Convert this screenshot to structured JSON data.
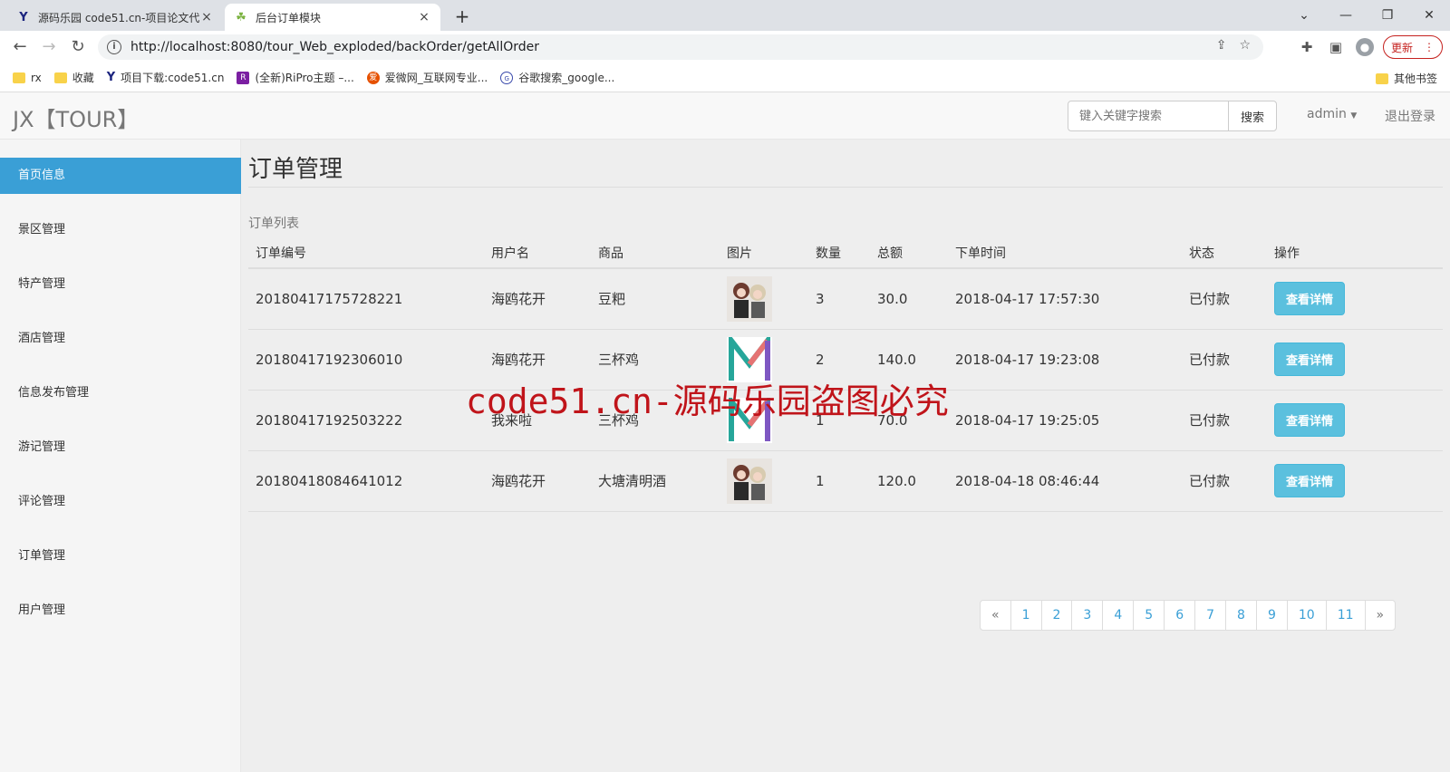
{
  "browser": {
    "tabs": [
      {
        "title": "源码乐园 code51.cn-项目论文代",
        "close": "×"
      },
      {
        "title": "后台订单模块",
        "close": "×"
      }
    ],
    "new_tab": "+",
    "window_controls": [
      "⌄",
      "—",
      "❐",
      "✕"
    ],
    "url": "http://localhost:8080/tour_Web_exploded/backOrder/getAllOrder",
    "update_label": "更新",
    "bookmarks": [
      {
        "label": "rx",
        "icon": "folder-icon"
      },
      {
        "label": "收藏",
        "icon": "folder-icon"
      },
      {
        "label": "项目下载:code51.cn",
        "icon": "y-logo-icon"
      },
      {
        "label": "(全新)RiPro主题 –...",
        "icon": "ripro-icon"
      },
      {
        "label": "爱微网_互联网专业...",
        "icon": "aiwei-icon"
      },
      {
        "label": "谷歌搜索_google...",
        "icon": "google-search-icon"
      }
    ],
    "other_bookmarks": "其他书签"
  },
  "app": {
    "brand": "JX【TOUR】",
    "search_placeholder": "键入关键字搜索",
    "search_button": "搜索",
    "user_menu": "admin",
    "logout": "退出登录"
  },
  "sidebar": {
    "items": [
      {
        "label": "首页信息",
        "active": true
      },
      {
        "label": "景区管理"
      },
      {
        "label": "特产管理"
      },
      {
        "label": "酒店管理"
      },
      {
        "label": "信息发布管理"
      },
      {
        "label": "游记管理"
      },
      {
        "label": "评论管理"
      },
      {
        "label": "订单管理"
      },
      {
        "label": "用户管理"
      }
    ]
  },
  "main": {
    "title": "订单管理",
    "list_caption": "订单列表",
    "columns": [
      "订单编号",
      "用户名",
      "商品",
      "图片",
      "数量",
      "总额",
      "下单时间",
      "状态",
      "操作"
    ],
    "rows": [
      {
        "id": "20180417175728221",
        "user": "海鸥花开",
        "product": "豆粑",
        "image": "anime-thumb",
        "qty": "3",
        "total": "30.0",
        "time": "2018-04-17 17:57:30",
        "status": "已付款",
        "action": "查看详情"
      },
      {
        "id": "20180417192306010",
        "user": "海鸥花开",
        "product": "三杯鸡",
        "image": "m-logo-thumb",
        "qty": "2",
        "total": "140.0",
        "time": "2018-04-17 19:23:08",
        "status": "已付款",
        "action": "查看详情"
      },
      {
        "id": "20180417192503222",
        "user": "我来啦",
        "product": "三杯鸡",
        "image": "m-logo-thumb",
        "qty": "1",
        "total": "70.0",
        "time": "2018-04-17 19:25:05",
        "status": "已付款",
        "action": "查看详情"
      },
      {
        "id": "20180418084641012",
        "user": "海鸥花开",
        "product": "大塘清明酒",
        "image": "anime-thumb",
        "qty": "1",
        "total": "120.0",
        "time": "2018-04-18 08:46:44",
        "status": "已付款",
        "action": "查看详情"
      }
    ],
    "pagination": [
      "«",
      "1",
      "2",
      "3",
      "4",
      "5",
      "6",
      "7",
      "8",
      "9",
      "10",
      "11",
      "»"
    ]
  },
  "watermark": "code51.cn-源码乐园盗图必究"
}
